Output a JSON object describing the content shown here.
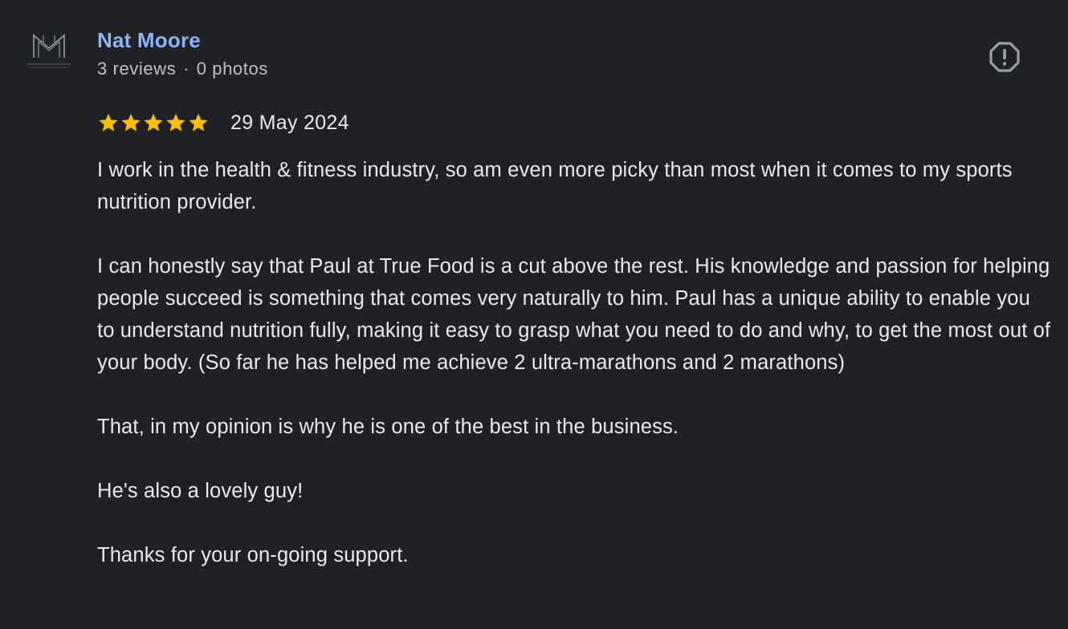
{
  "reviewer": {
    "name": "Nat Moore",
    "reviews_count": "3 reviews",
    "separator": "·",
    "photos_count": "0 photos",
    "avatar_icon": "monogram-m-logo-icon"
  },
  "actions": {
    "report_icon": "report-icon"
  },
  "review": {
    "rating": 5,
    "max_rating": 5,
    "star_color": "#fbbc04",
    "date": "29 May 2024",
    "paragraphs": [
      "I work in the health & fitness industry, so am even more picky than most when it comes to my sports nutrition provider.",
      "I can honestly say that Paul at True Food is a cut above the rest. His knowledge and passion for helping people succeed is something that comes very naturally to him. Paul has a unique ability to enable you to understand nutrition fully, making it easy to grasp what you need to do and why, to get the most out of your body. (So far he has helped me achieve 2 ultra-marathons and 2 marathons)",
      "That, in my opinion is why he is one of the best in the business.",
      "He's also a lovely guy!",
      "Thanks for your on-going support."
    ]
  },
  "colors": {
    "background": "#202124",
    "name_link": "#8ab4f8",
    "text_primary": "#e8eaed",
    "text_secondary": "#bdc1c6"
  }
}
